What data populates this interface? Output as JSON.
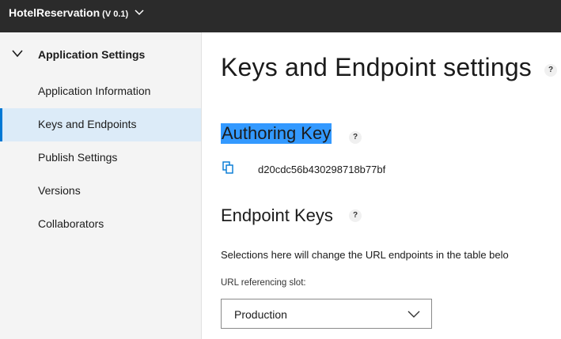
{
  "topbar": {
    "app_name": "HotelReservation",
    "version": "(V 0.1)",
    "chevron_icon": "chevron-down-icon"
  },
  "sidebar": {
    "section_title": "Application Settings",
    "items": [
      {
        "label": "Application Information",
        "active": false
      },
      {
        "label": "Keys and Endpoints",
        "active": true
      },
      {
        "label": "Publish Settings",
        "active": false
      },
      {
        "label": "Versions",
        "active": false
      },
      {
        "label": "Collaborators",
        "active": false
      }
    ]
  },
  "main": {
    "title": "Keys and Endpoint settings",
    "help_glyph": "?",
    "authoring": {
      "title": "Authoring Key",
      "key": "d20cdc56b430298718b77bf",
      "copy_icon": "copy-icon"
    },
    "endpoint": {
      "title": "Endpoint Keys",
      "selections_text": "Selections here will change the URL endpoints in the table belo",
      "slot_label": "URL referencing slot:",
      "slot_value": "Production"
    }
  },
  "colors": {
    "topbar": "#2b2b2b",
    "accent": "#0078d4",
    "active_bg": "#dcebf8",
    "highlight": "#3399ff"
  }
}
